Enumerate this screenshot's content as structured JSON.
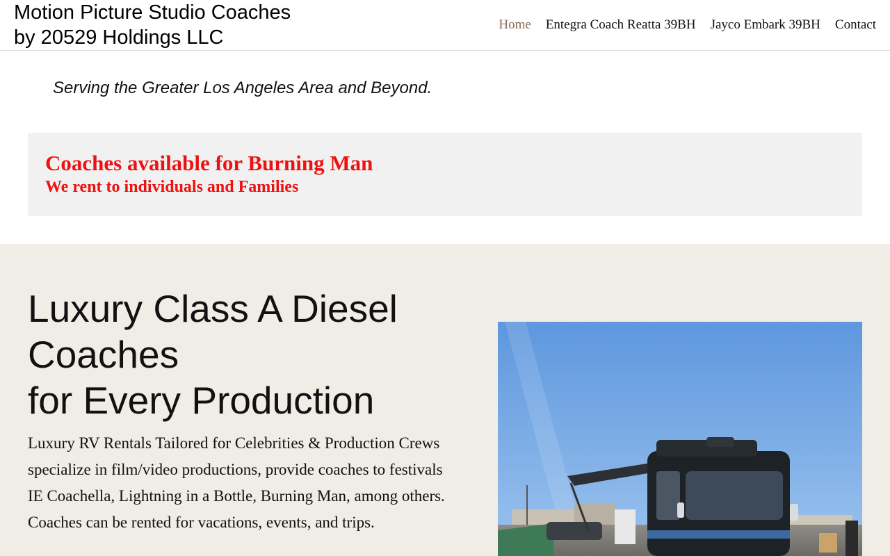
{
  "brand": {
    "line1": "Motion Picture Studio Coaches",
    "line2": "by 20529 Holdings LLC"
  },
  "nav": [
    {
      "label": "Home",
      "active": true
    },
    {
      "label": "Entegra Coach Reatta 39BH",
      "active": false
    },
    {
      "label": "Jayco Embark 39BH",
      "active": false
    },
    {
      "label": "Contact",
      "active": false
    }
  ],
  "tagline": "Serving the Greater Los Angeles Area and Beyond.",
  "notice": {
    "title": "Coaches available for Burning Man",
    "subtitle": "We rent to individuals and Families",
    "color": "#ee1111"
  },
  "hero": {
    "heading_lines": [
      "Luxury Class A Diesel",
      "Coaches",
      "for Every Production"
    ],
    "text_lines": [
      "Luxury RV Rentals Tailored for Celebrities & Production Crews",
      "specialize in film/video productions, provide coaches to festivals",
      "IE Coachella, Lightning in a Bottle, Burning Man, among others.",
      "Coaches can be rented for vacations, events, and trips."
    ]
  },
  "colors": {
    "nav_active": "#8a6a55",
    "hero_background": "#f0ece6",
    "notice_background": "#f1f1f1"
  }
}
